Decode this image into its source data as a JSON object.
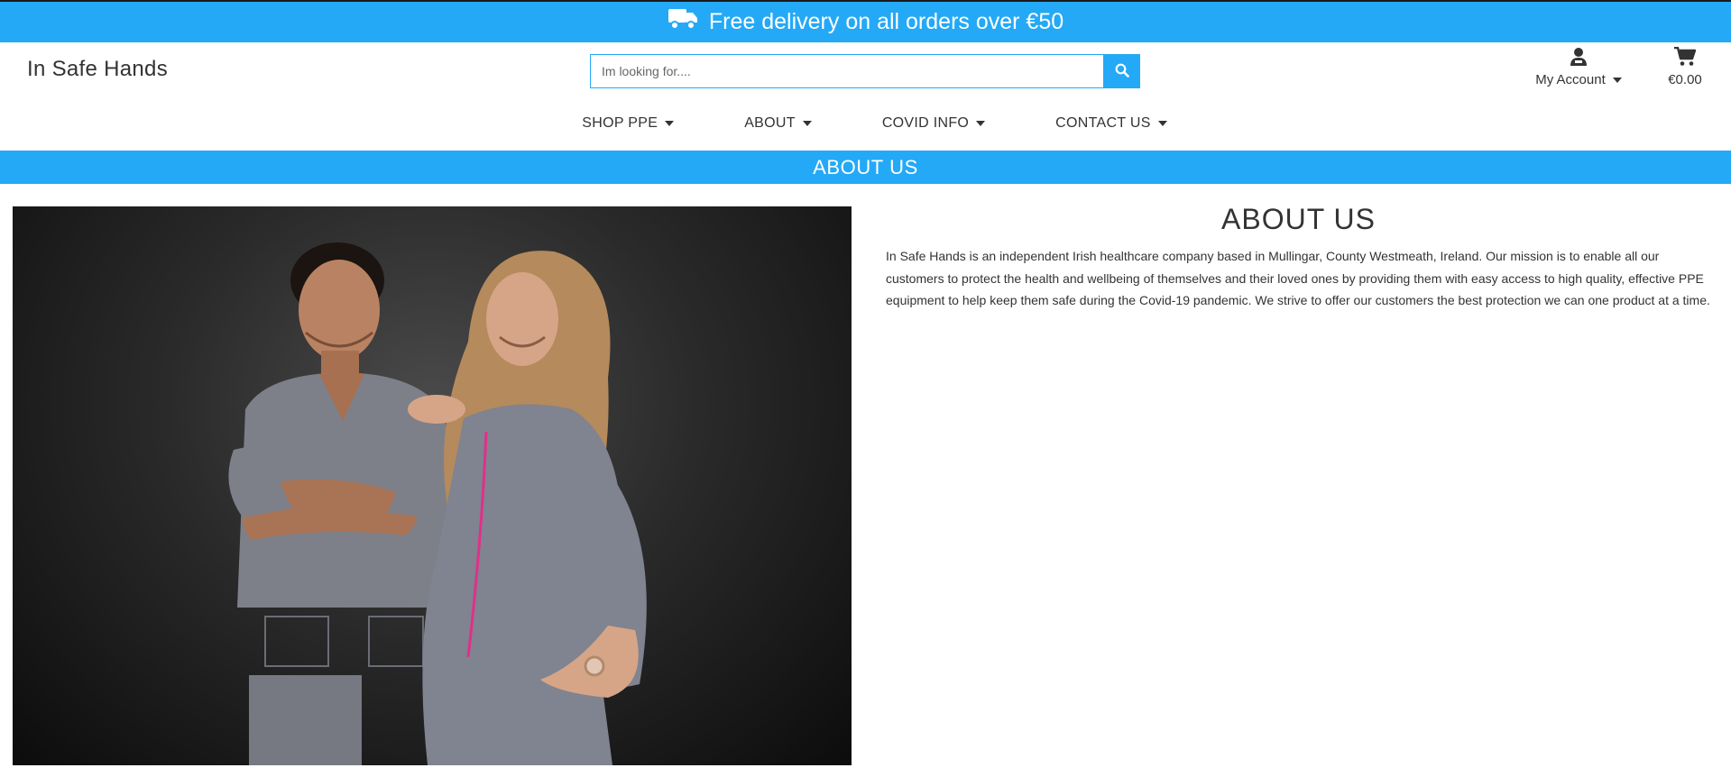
{
  "delivery_banner": {
    "text": "Free delivery on all orders over €50",
    "icon": "truck-icon"
  },
  "header": {
    "brand": "In Safe Hands",
    "search": {
      "placeholder": "Im looking for....",
      "value": "",
      "button_icon": "search-icon"
    },
    "account": {
      "label": "My Account",
      "icon": "user-icon"
    },
    "cart": {
      "amount": "€0.00",
      "icon": "shopping-cart-icon"
    }
  },
  "nav": {
    "items": [
      {
        "label": "SHOP PPE"
      },
      {
        "label": "ABOUT"
      },
      {
        "label": "COVID INFO"
      },
      {
        "label": "CONTACT US"
      }
    ]
  },
  "page_title": "ABOUT US",
  "about": {
    "heading": "ABOUT US",
    "text": "In Safe Hands is an independent Irish healthcare company based in Mullingar, County Westmeath, Ireland. Our mission is to enable all our customers to protect the health and wellbeing of themselves and their loved ones by providing them with easy access to high quality, effective PPE equipment to help keep them safe during the Covid-19 pandemic. We strive to offer our customers the best protection we can one product at a time."
  },
  "colors": {
    "accent": "#24a9f6",
    "text": "#333333",
    "scrubs": "#7d8089",
    "photo_background": "#1e1e1e"
  }
}
